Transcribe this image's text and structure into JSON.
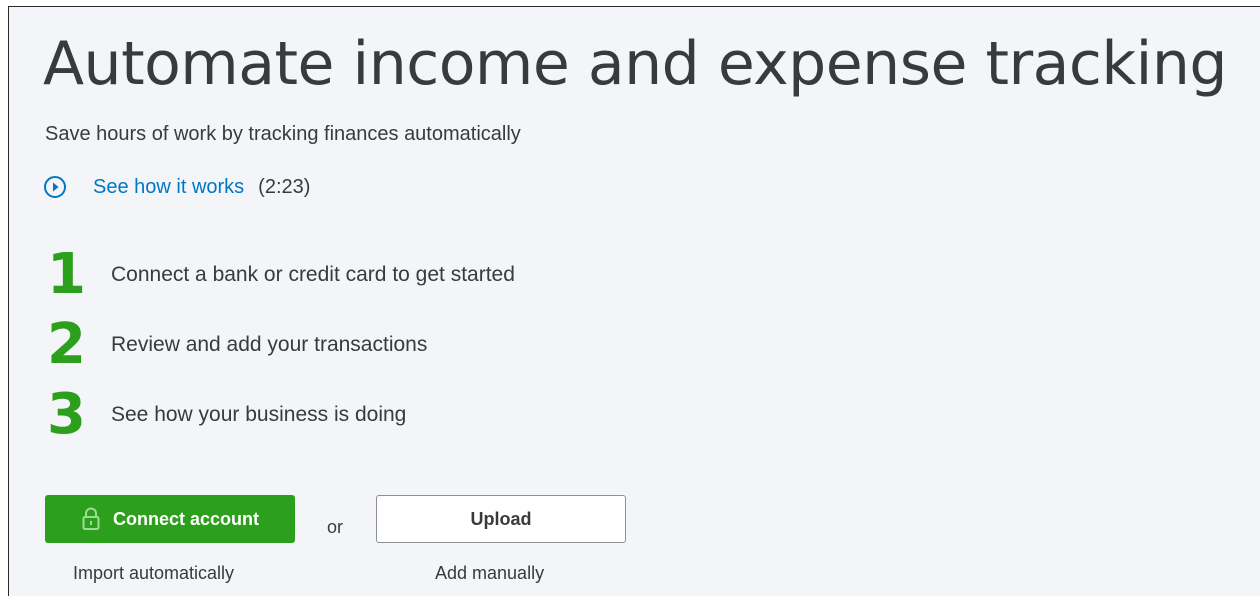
{
  "header": {
    "title": "Automate income and expense tracking",
    "subtitle": "Save hours of work by tracking finances automatically"
  },
  "video": {
    "icon": "play-circle-icon",
    "label": "See how it works",
    "duration": "(2:23)"
  },
  "steps": [
    {
      "number": "1",
      "text": "Connect a bank or credit card to get started"
    },
    {
      "number": "2",
      "text": "Review and add your transactions"
    },
    {
      "number": "3",
      "text": "See how your business is doing"
    }
  ],
  "actions": {
    "connect_label": "Connect account",
    "connect_icon": "lock-icon",
    "connect_caption": "Import automatically",
    "or_text": "or",
    "upload_label": "Upload",
    "upload_caption": "Add manually"
  },
  "colors": {
    "accent_green": "#2ca01c",
    "link_blue": "#0077c5",
    "text": "#393a3d",
    "background": "#f4f5f8"
  }
}
